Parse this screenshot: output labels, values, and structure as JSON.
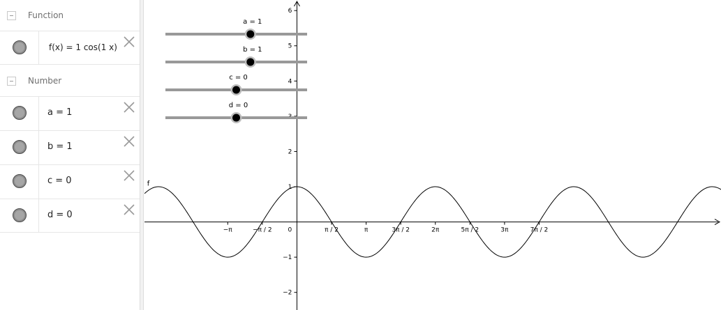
{
  "algebra": {
    "function_group": {
      "label": "Function"
    },
    "function_item": {
      "text": "f(x) = 1  cos(1 x)"
    },
    "number_group": {
      "label": "Number"
    },
    "number_items": [
      {
        "text": "a = 1"
      },
      {
        "text": "b = 1"
      },
      {
        "text": "c = 0"
      },
      {
        "text": "d = 0"
      }
    ]
  },
  "sliders": [
    {
      "label": "a = 1",
      "value": 1,
      "min": -5,
      "max": 5
    },
    {
      "label": "b = 1",
      "value": 1,
      "min": -5,
      "max": 5
    },
    {
      "label": "c = 0",
      "value": 0,
      "min": -5,
      "max": 5
    },
    {
      "label": "d = 0",
      "value": 0,
      "min": -5,
      "max": 5
    }
  ],
  "colors": {
    "slider_line": "#999999",
    "knob": "#000000",
    "curve": "#000000",
    "axis": "#000000"
  },
  "chart_data": {
    "type": "line",
    "function_label": "f",
    "xlim": [
      -6.92,
      19.25
    ],
    "ylim": [
      -2.5,
      6.3
    ],
    "x_ticks": [
      {
        "value": -3.14159,
        "label": "−π"
      },
      {
        "value": -1.5708,
        "label": "−π / 2"
      },
      {
        "value": 1.5708,
        "label": "π / 2"
      },
      {
        "value": 3.14159,
        "label": "π"
      },
      {
        "value": 4.71239,
        "label": "3π / 2"
      },
      {
        "value": 6.28319,
        "label": "2π"
      },
      {
        "value": 7.85398,
        "label": "5π / 2"
      },
      {
        "value": 9.42478,
        "label": "3π"
      },
      {
        "value": 10.9956,
        "label": "7π / 2"
      }
    ],
    "origin_label": "0",
    "y_ticks": [
      {
        "value": 6,
        "label": "6"
      },
      {
        "value": 5,
        "label": "5"
      },
      {
        "value": 4,
        "label": "4"
      },
      {
        "value": 3,
        "label": "3"
      },
      {
        "value": 2,
        "label": "2"
      },
      {
        "value": 1,
        "label": "1"
      },
      {
        "value": -1,
        "label": "−1"
      },
      {
        "value": -2,
        "label": "−2"
      }
    ],
    "series": [
      {
        "expression": "1 cos(1 x)"
      }
    ]
  }
}
